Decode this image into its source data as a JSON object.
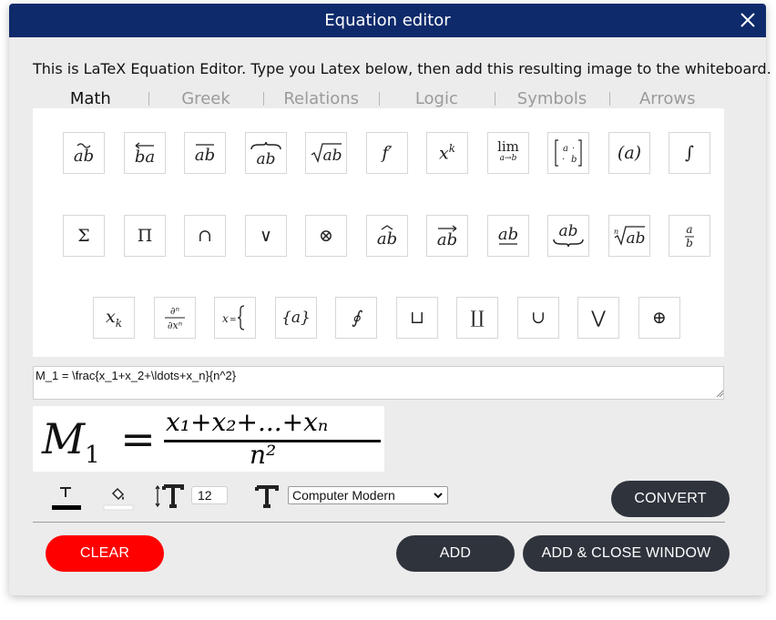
{
  "window": {
    "title": "Equation editor"
  },
  "instructions": "This is LaTeX Equation Editor. Type you Latex below, then add this resulting image to the whiteboard.",
  "tabs": [
    {
      "label": "Math",
      "active": true
    },
    {
      "label": "Greek",
      "active": false
    },
    {
      "label": "Relations",
      "active": false
    },
    {
      "label": "Logic",
      "active": false
    },
    {
      "label": "Symbols",
      "active": false
    },
    {
      "label": "Arrows",
      "active": false
    }
  ],
  "symbols": {
    "row1": [
      "ab",
      "ba",
      "ab",
      "ab",
      "√ab",
      "f′",
      "x",
      "lim",
      "a b",
      "(a)",
      "∫"
    ],
    "row2": [
      "Σ",
      "Π",
      "∩",
      "∨",
      "⊗",
      "ab",
      "ab",
      "ab",
      "ab",
      "√ab",
      "a b"
    ],
    "row3": [
      "x",
      "∂ⁿ ∂xⁿ",
      "x={",
      "{a}",
      "∮",
      "⊔",
      "∐",
      "∪",
      "⋁",
      "⊕"
    ]
  },
  "editor": {
    "latex": "M_1 = \\frac{x_1+x_2+\\ldots+x_n}{n^2}"
  },
  "preview": {
    "lhs": "M",
    "lhs_sub": "1",
    "eq": "=",
    "numerator": "x₁+x₂+...+xₙ",
    "denominator": "n²"
  },
  "toolbar": {
    "text_color": "#000000",
    "fill_color": "#ffffff",
    "font_size": "12",
    "font_family": "Computer Modern",
    "convert_label": "CONVERT"
  },
  "actions": {
    "clear_label": "CLEAR",
    "add_label": "ADD",
    "add_close_label": "ADD & CLOSE WINDOW"
  },
  "colors": {
    "titlebar": "#0e2a6b",
    "clear": "#ff0000",
    "dark_button": "#2f333c"
  }
}
